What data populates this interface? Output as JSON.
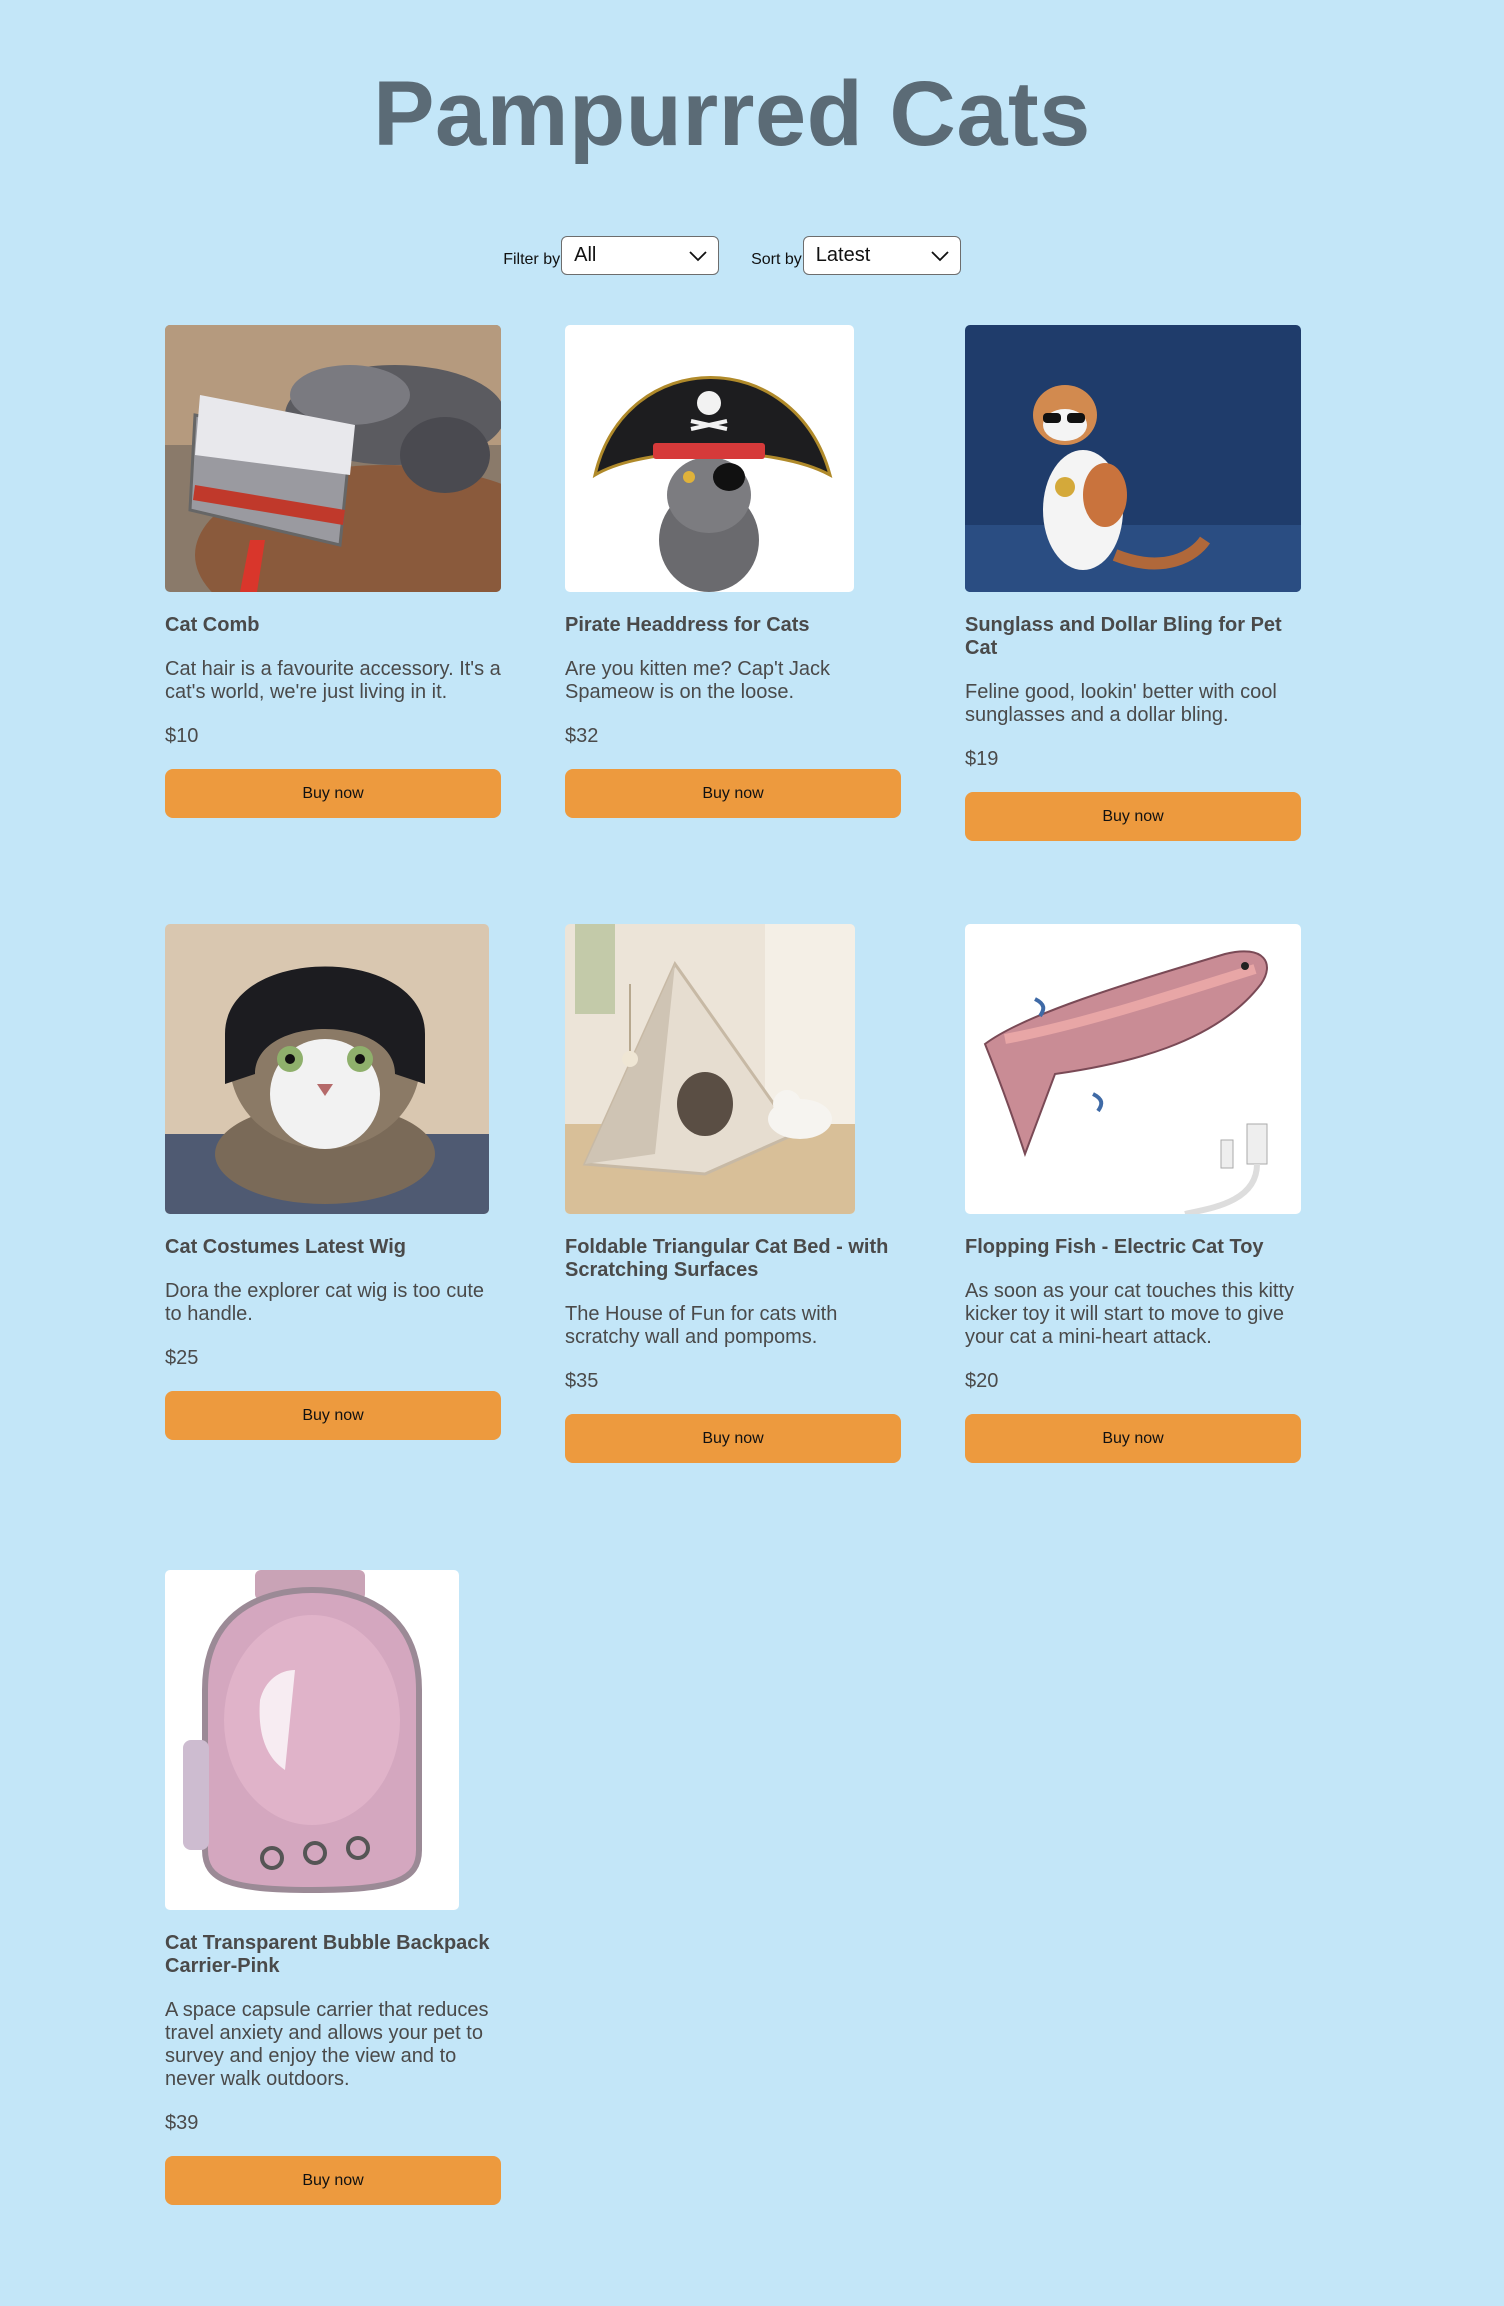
{
  "header": {
    "title": "Pampurred Cats"
  },
  "filter": {
    "label": "Filter by",
    "value": "All"
  },
  "sort": {
    "label": "Sort by",
    "value": "Latest"
  },
  "colors": {
    "background": "#c3e6f8",
    "title": "#5b6b76",
    "button": "#ed9a3e"
  },
  "products": [
    {
      "name": "Cat Comb",
      "description": "Cat hair is a favourite accessory. It's a cat's world, we're just living in it.",
      "price": "$10",
      "button": "Buy now"
    },
    {
      "name": "Pirate Headdress for Cats",
      "description": "Are you kitten me? Cap't Jack Spameow is on the loose.",
      "price": "$32",
      "button": "Buy now"
    },
    {
      "name": "Sunglass and Dollar Bling for Pet Cat",
      "description": "Feline good, lookin' better with cool sunglasses and a dollar bling.",
      "price": "$19",
      "button": "Buy now"
    },
    {
      "name": "Cat Costumes Latest Wig",
      "description": "Dora the explorer cat wig is too cute to handle.",
      "price": "$25",
      "button": "Buy now"
    },
    {
      "name": "Foldable Triangular Cat Bed - with Scratching Surfaces",
      "description": "The House of Fun for cats with scratchy wall and pompoms.",
      "price": "$35",
      "button": "Buy now"
    },
    {
      "name": "Flopping Fish - Electric Cat Toy",
      "description": "As soon as your cat touches this kitty kicker toy it will start to move to give your cat a mini-heart attack.",
      "price": "$20",
      "button": "Buy now"
    },
    {
      "name": "Cat Transparent Bubble Backpack Carrier-Pink",
      "description": "A space capsule carrier that reduces travel anxiety and allows your pet to survey and enjoy the view and to never walk outdoors.",
      "price": "$39",
      "button": "Buy now"
    }
  ]
}
